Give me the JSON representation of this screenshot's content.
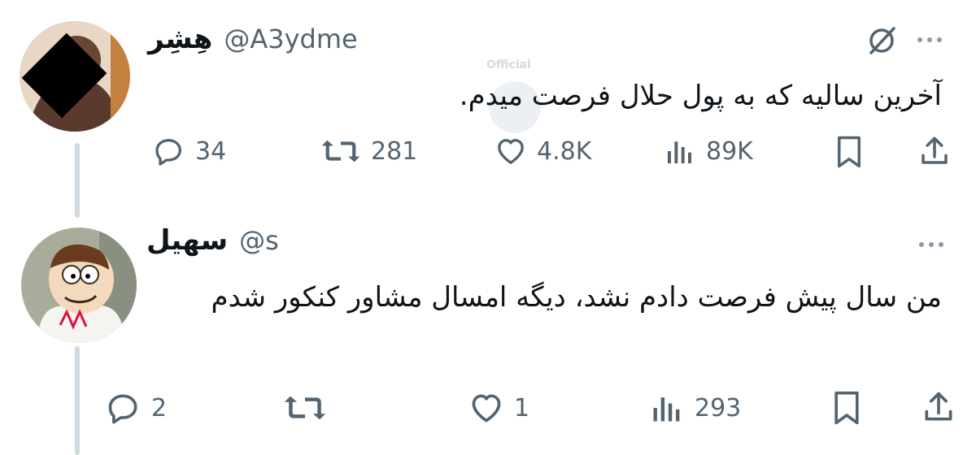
{
  "tweets": [
    {
      "display_name": "هِشِر",
      "handle": "@A3ydme",
      "text": "آخرین سالیه که به پول حلال فرصت میدم.",
      "stats": {
        "replies": "34",
        "retweets": "281",
        "likes": "4.8K",
        "views": "89K"
      }
    },
    {
      "display_name": "سهیل",
      "handle": "@s",
      "text": "من سال پیش فرصت دادم نشد، دیگه امسال مشاور کنکور شدم",
      "stats": {
        "replies": "2",
        "retweets": "",
        "likes": "1",
        "views": "293"
      }
    }
  ],
  "watermark_text": "Official",
  "icons": [
    "reply-icon",
    "retweet-icon",
    "like-icon",
    "views-icon",
    "bookmark-icon",
    "share-icon",
    "more-icon",
    "grok-icon"
  ]
}
